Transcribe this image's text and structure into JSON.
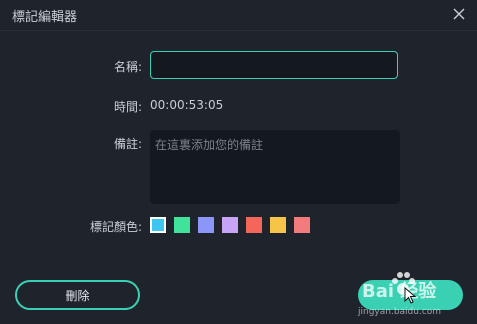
{
  "dialog": {
    "title": "標記編輯器"
  },
  "form": {
    "name_label": "名稱:",
    "name_value": "",
    "time_label": "時間:",
    "time_value": "00:00:53:05",
    "note_label": "備註:",
    "note_placeholder": "在這裏添加您的備註",
    "color_label": "標記顏色:"
  },
  "colors": [
    {
      "hex": "#3ec5f0",
      "selected": true
    },
    {
      "hex": "#3fe39a",
      "selected": false
    },
    {
      "hex": "#8c96f8",
      "selected": false
    },
    {
      "hex": "#c8a4f6",
      "selected": false
    },
    {
      "hex": "#f4665a",
      "selected": false
    },
    {
      "hex": "#f5c448",
      "selected": false
    },
    {
      "hex": "#f47b7b",
      "selected": false
    }
  ],
  "actions": {
    "delete_label": "刪除"
  },
  "watermark": {
    "text": "Bai 经验",
    "subtext": "jingyan.baidu.com"
  },
  "theme": {
    "accent": "#3ad0b3",
    "background": "#1f242c",
    "field_background": "#141920"
  }
}
